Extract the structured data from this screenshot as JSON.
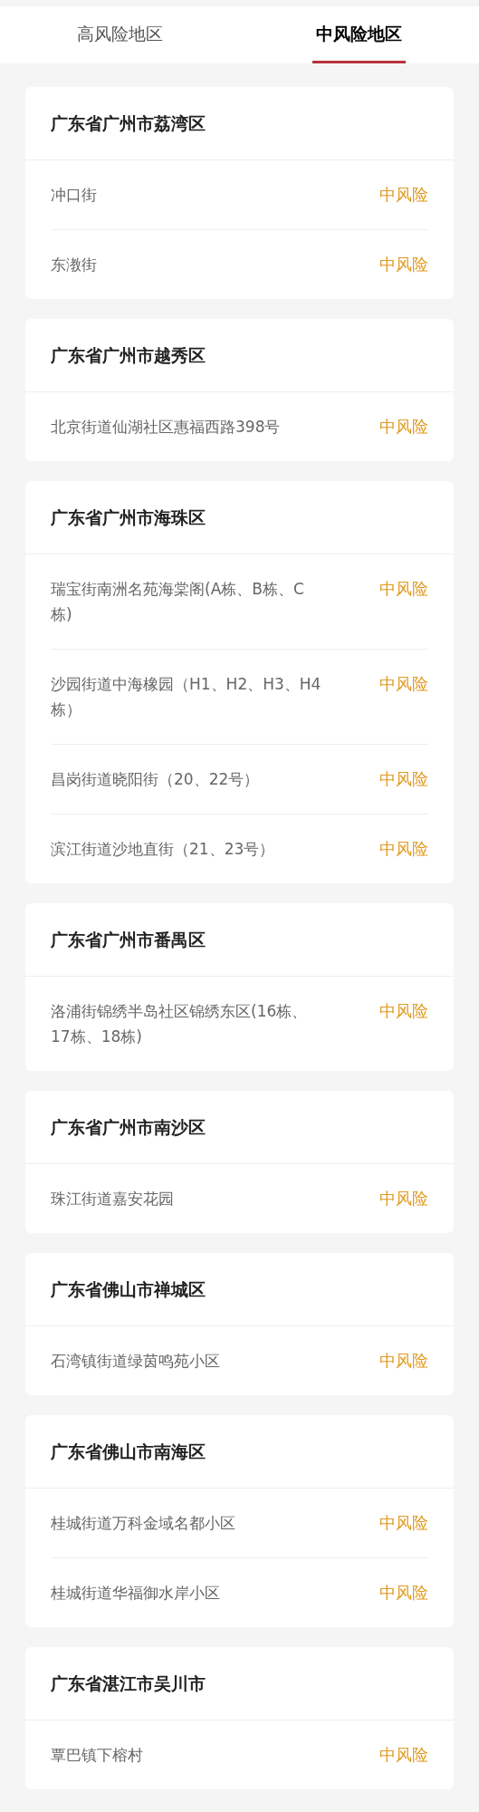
{
  "tabs": [
    {
      "label": "高风险地区",
      "selected": false
    },
    {
      "label": "中风险地区",
      "selected": true
    }
  ],
  "regions": [
    {
      "title": "广东省广州市荔湾区",
      "areas": [
        {
          "name": "冲口街",
          "risk": "中风险"
        },
        {
          "name": "东漖街",
          "risk": "中风险"
        }
      ]
    },
    {
      "title": "广东省广州市越秀区",
      "areas": [
        {
          "name": "北京街道仙湖社区惠福西路398号",
          "risk": "中风险"
        }
      ]
    },
    {
      "title": "广东省广州市海珠区",
      "areas": [
        {
          "name": "瑞宝街南洲名苑海棠阁(A栋、B栋、C栋)",
          "risk": "中风险"
        },
        {
          "name": "沙园街道中海橡园（H1、H2、H3、H4栋）",
          "risk": "中风险"
        },
        {
          "name": "昌岗街道晓阳街（20、22号）",
          "risk": "中风险"
        },
        {
          "name": "滨江街道沙地直街（21、23号）",
          "risk": "中风险"
        }
      ]
    },
    {
      "title": "广东省广州市番禺区",
      "areas": [
        {
          "name": "洛浦街锦绣半岛社区锦绣东区(16栋、17栋、18栋)",
          "risk": "中风险"
        }
      ]
    },
    {
      "title": "广东省广州市南沙区",
      "areas": [
        {
          "name": "珠江街道嘉安花园",
          "risk": "中风险"
        }
      ]
    },
    {
      "title": "广东省佛山市禅城区",
      "areas": [
        {
          "name": "石湾镇街道绿茵鸣苑小区",
          "risk": "中风险"
        }
      ]
    },
    {
      "title": "广东省佛山市南海区",
      "areas": [
        {
          "name": "桂城街道万科金域名都小区",
          "risk": "中风险"
        },
        {
          "name": "桂城街道华福御水岸小区",
          "risk": "中风险"
        }
      ]
    },
    {
      "title": "广东省湛江市吴川市",
      "areas": [
        {
          "name": "覃巴镇下榕村",
          "risk": "中风险"
        }
      ]
    }
  ]
}
